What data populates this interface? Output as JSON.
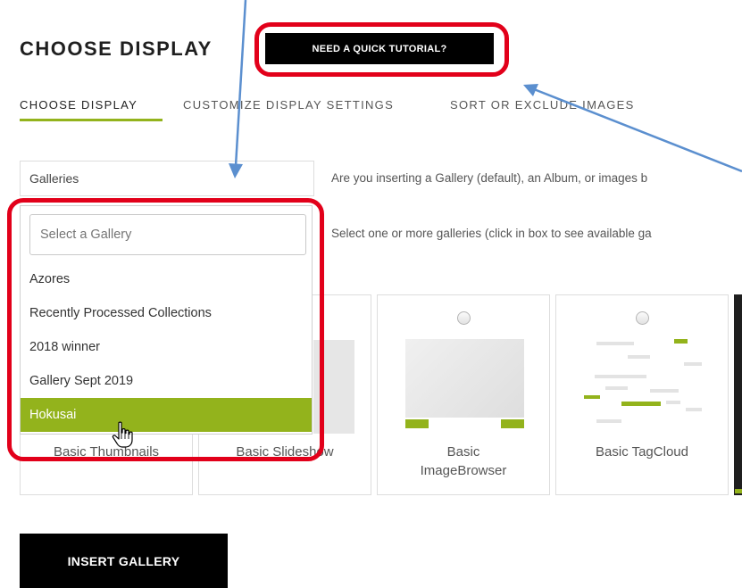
{
  "header": {
    "title": "CHOOSE DISPLAY",
    "tutorial_button": "NEED A QUICK TUTORIAL?"
  },
  "tabs": [
    {
      "label": "CHOOSE DISPLAY",
      "active": true
    },
    {
      "label": "CUSTOMIZE DISPLAY SETTINGS",
      "active": false
    },
    {
      "label": "SORT OR EXCLUDE IMAGES",
      "active": false
    }
  ],
  "source": {
    "value": "Galleries",
    "help": "Are you inserting a Gallery (default), an Album, or images b"
  },
  "gallery_select": {
    "placeholder": "Select a Gallery",
    "help": "Select one or more galleries (click in box to see available ga",
    "options": [
      "Azores",
      "Recently Processed Collections",
      "2018 winner",
      "Gallery Sept 2019",
      "Hokusai"
    ],
    "highlighted": "Hokusai"
  },
  "display_types": [
    {
      "label": "Basic Thumbnails"
    },
    {
      "label": "Basic Slideshow"
    },
    {
      "label_line1": "Basic",
      "label_line2": "ImageBrowser"
    },
    {
      "label": "Basic TagCloud"
    }
  ],
  "insert_button": "INSERT GALLERY",
  "colors": {
    "accent": "#93b31c",
    "annotation_red": "#e2001a",
    "annotation_arrow": "#5b8fcf",
    "button_bg": "#000000"
  }
}
